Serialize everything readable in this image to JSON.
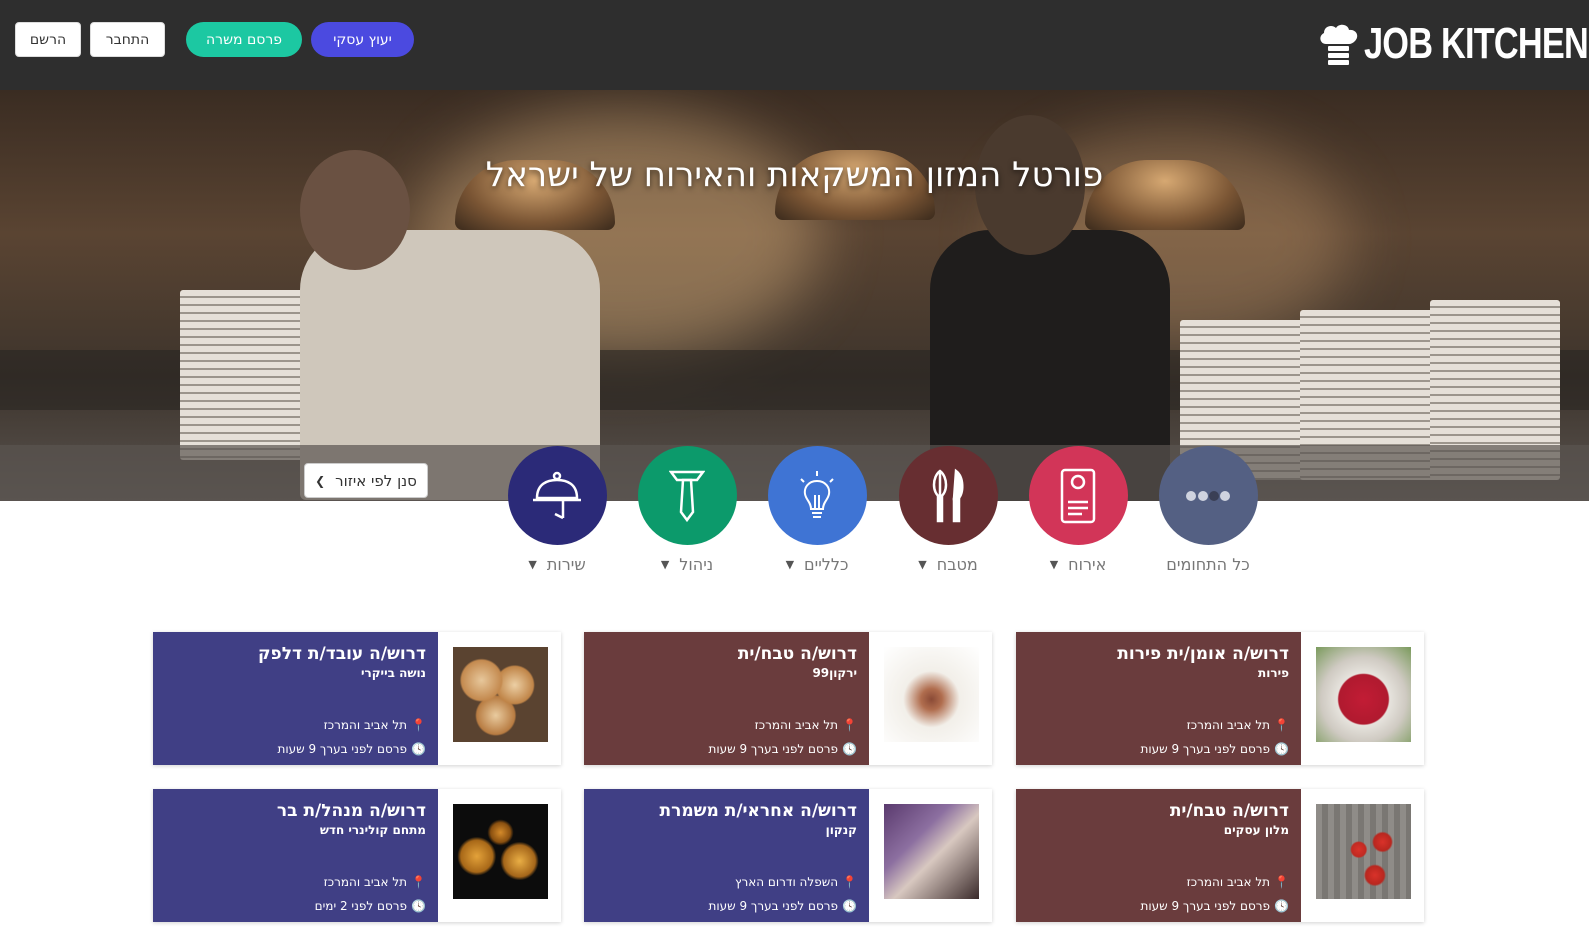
{
  "header": {
    "brand": "JOB KITCHEN",
    "register_label": "הרשם",
    "login_label": "התחבר",
    "post_job_label": "פרסם משרה",
    "consultant_label": "יעוץ עסקי",
    "colors": {
      "bg": "#2e2e2e",
      "post": "#1cc8a2",
      "consult": "#4b4ae0"
    }
  },
  "hero": {
    "title": "פורטל המזון המשקאות והאירוח של ישראל",
    "region_filter": "סנן לפי איזור"
  },
  "categories": [
    {
      "label": "כל התחומים",
      "icon": "more-dots-icon",
      "color": "#546083"
    },
    {
      "label": "אירוח",
      "icon": "door-hanger-icon",
      "color": "#d23558"
    },
    {
      "label": "מטבח",
      "icon": "whisk-knife-icon",
      "color": "#672e31"
    },
    {
      "label": "כלליים",
      "icon": "lightbulb-icon",
      "color": "#3f74d4"
    },
    {
      "label": "ניהול",
      "icon": "tie-icon",
      "color": "#0c9a6b"
    },
    {
      "label": "שירות",
      "icon": "cloche-icon",
      "color": "#2b2a78"
    }
  ],
  "jobs": [
    {
      "title": "דרוש/ה אומן/ית פירות",
      "company": "פירות",
      "location": "תל אביב והמרכז",
      "posted": "פרסם לפני בערך 9 שעות",
      "image": "berries-photo",
      "color": "#6a3c3d"
    },
    {
      "title": "דרוש/ה טבח/ית",
      "company": "ירקון99",
      "location": "תל אביב והמרכז",
      "posted": "פרסם לפני בערך 9 שעות",
      "image": "plated-lamb-photo",
      "color": "#6a3c3d"
    },
    {
      "title": "דרוש/ה עובד/ת דלפק",
      "company": "נושה בייקרי",
      "location": "תל אביב והמרכז",
      "posted": "פרסם לפני בערך 9 שעות",
      "image": "pastries-photo",
      "color": "#403f85"
    },
    {
      "title": "דרוש/ה טבח/ית",
      "company": "מלון עסקים",
      "location": "תל אביב והמרכז",
      "posted": "פרסם לפני בערך 9 שעות",
      "image": "tomatoes-photo",
      "color": "#6a3c3d"
    },
    {
      "title": "דרוש/ה אחראי/ת משמרת",
      "company": "קנקון",
      "location": "השפלה ודרום הארץ",
      "posted": "פרסם לפני בערך 9 שעות",
      "image": "wine-glasses-photo",
      "color": "#403f85"
    },
    {
      "title": "דרוש/ה מנהל/ת בר",
      "company": "מתחם קולינרי חדש",
      "location": "תל אביב והמרכז",
      "posted": "פרסם לפני 2 ימים",
      "image": "whiskey-glasses-photo",
      "color": "#403f85"
    }
  ]
}
